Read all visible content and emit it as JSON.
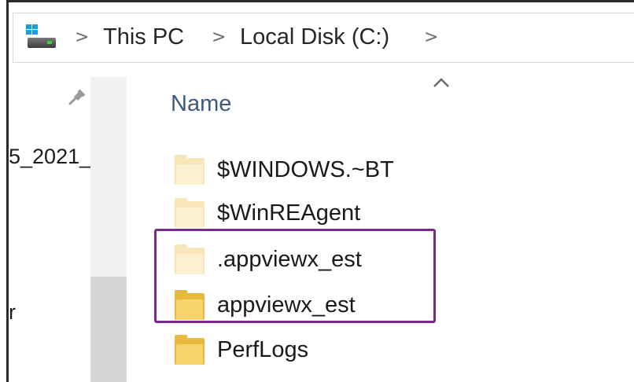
{
  "address_bar": {
    "icon": "drive-icon",
    "crumbs": [
      "This PC",
      "Local Disk (C:)"
    ],
    "separator": ">"
  },
  "nav_pane": {
    "pin_icon": "pin-icon",
    "up_icon": "chevron-up-icon",
    "partial_text_1": "5_2021_",
    "partial_text_2": "r"
  },
  "file_list": {
    "sort_icon": "chevron-up-icon",
    "column_header": "Name",
    "items": [
      {
        "name": "$WINDOWS.~BT",
        "style": "hidden"
      },
      {
        "name": "$WinREAgent",
        "style": "hidden"
      },
      {
        "name": ".appviewx_est",
        "style": "hidden"
      },
      {
        "name": "appviewx_est",
        "style": "normal"
      },
      {
        "name": "PerfLogs",
        "style": "normal"
      }
    ]
  },
  "highlight": {
    "color": "#7a2a8a",
    "items": [
      ".appviewx_est",
      "appviewx_est"
    ]
  }
}
